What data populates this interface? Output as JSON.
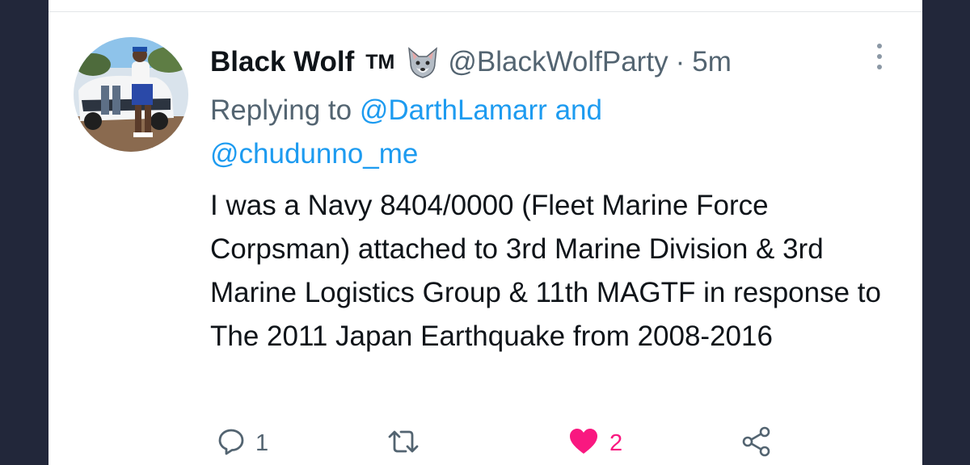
{
  "tweet": {
    "display_name": "Black Wolf",
    "name_suffix": "TM",
    "name_emoji": "wolf-face-emoji",
    "handle": "@BlackWolfParty",
    "separator": "·",
    "time_ago": "5m",
    "replying_prefix": "Replying to",
    "replying_user_1": "@DarthLamarr",
    "replying_and": "and",
    "replying_user_2": "@chudunno_me",
    "text": "I was a Navy 8404/0000 (Fleet Marine Force Corpsman) attached to 3rd Marine Division & 3rd Marine Logistics Group & 11th MAGTF in response to The 2011 Japan Earthquake from 2008-2016"
  },
  "actions": {
    "reply_count": "1",
    "retweet_count": "",
    "like_count": "2",
    "liked": true
  },
  "icons": {
    "reply": "speech-bubble-icon",
    "retweet": "retweet-icon",
    "like": "heart-icon",
    "share": "share-icon",
    "more": "more-vertical-icon"
  },
  "colors": {
    "background": "#22273a",
    "card": "#ffffff",
    "text_primary": "#0f1419",
    "text_secondary": "#536471",
    "link": "#1d9bf0",
    "like": "#f91880"
  }
}
